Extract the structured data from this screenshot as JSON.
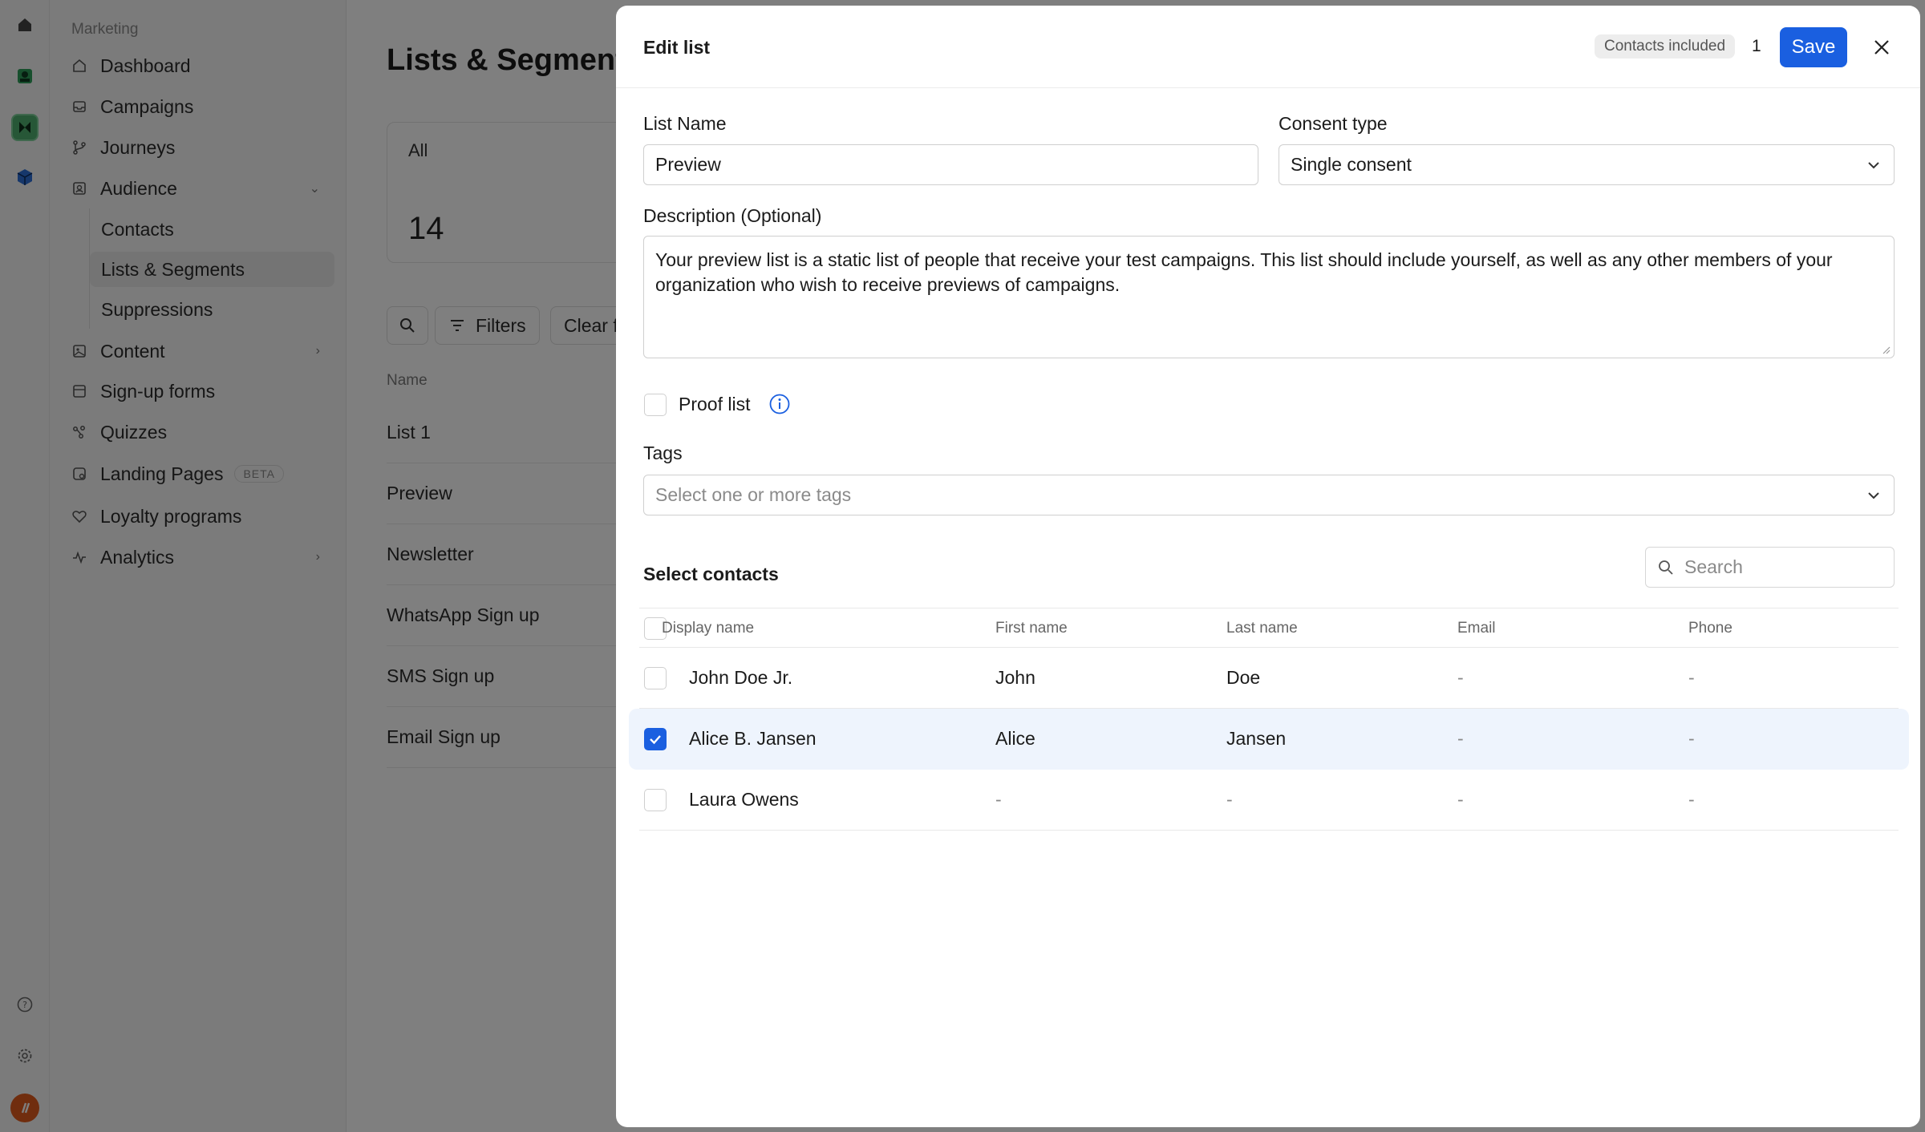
{
  "sidebar": {
    "section": "Marketing",
    "items": [
      {
        "label": "Dashboard",
        "icon": "home-icon"
      },
      {
        "label": "Campaigns",
        "icon": "inbox-icon"
      },
      {
        "label": "Journeys",
        "icon": "branch-icon"
      },
      {
        "label": "Audience",
        "icon": "audience-icon"
      },
      {
        "label": "Contacts"
      },
      {
        "label": "Lists & Segments"
      },
      {
        "label": "Suppressions"
      },
      {
        "label": "Content",
        "icon": "content-icon"
      },
      {
        "label": "Sign-up forms",
        "icon": "form-icon"
      },
      {
        "label": "Quizzes",
        "icon": "quiz-icon"
      },
      {
        "label": "Landing Pages",
        "icon": "page-icon",
        "badge": "BETA"
      },
      {
        "label": "Loyalty programs",
        "icon": "heart-icon"
      },
      {
        "label": "Analytics",
        "icon": "pulse-icon"
      }
    ]
  },
  "main": {
    "title": "Lists & Segments",
    "stat": {
      "label": "All",
      "value": "14"
    },
    "toolbar": {
      "filters": "Filters",
      "clear": "Clear f"
    },
    "table_header": "Name",
    "lists": [
      "List 1",
      "Preview",
      "Newsletter",
      "WhatsApp Sign up",
      "SMS Sign up",
      "Email Sign up"
    ]
  },
  "modal": {
    "title": "Edit list",
    "contacts_included_label": "Contacts included",
    "contacts_included_count": "1",
    "save_label": "Save",
    "list_name_label": "List Name",
    "list_name_value": "Preview",
    "consent_label": "Consent type",
    "consent_value": "Single consent",
    "description_label": "Description (Optional)",
    "description_value": "Your preview list is a static list of people that receive your test campaigns. This list should include yourself, as well as any other members of your organization who wish to receive previews of campaigns.",
    "proof_list_label": "Proof list",
    "tags_label": "Tags",
    "tags_placeholder": "Select one or more tags",
    "select_contacts_label": "Select contacts",
    "search_placeholder": "Search",
    "columns": [
      "Display name",
      "First name",
      "Last name",
      "Email",
      "Phone"
    ],
    "rows": [
      {
        "display": "John Doe Jr.",
        "first": "John",
        "last": "Doe",
        "email": "-",
        "phone": "-",
        "checked": false
      },
      {
        "display": "Alice B. Jansen",
        "first": "Alice",
        "last": "Jansen",
        "email": "-",
        "phone": "-",
        "checked": true
      },
      {
        "display": "Laura Owens",
        "first": "-",
        "last": "-",
        "email": "-",
        "phone": "-",
        "checked": false
      }
    ]
  },
  "colors": {
    "accent": "#1a5fe0",
    "selected_row": "#eef4fd",
    "overlay": "rgba(0,0,0,0.5)"
  }
}
